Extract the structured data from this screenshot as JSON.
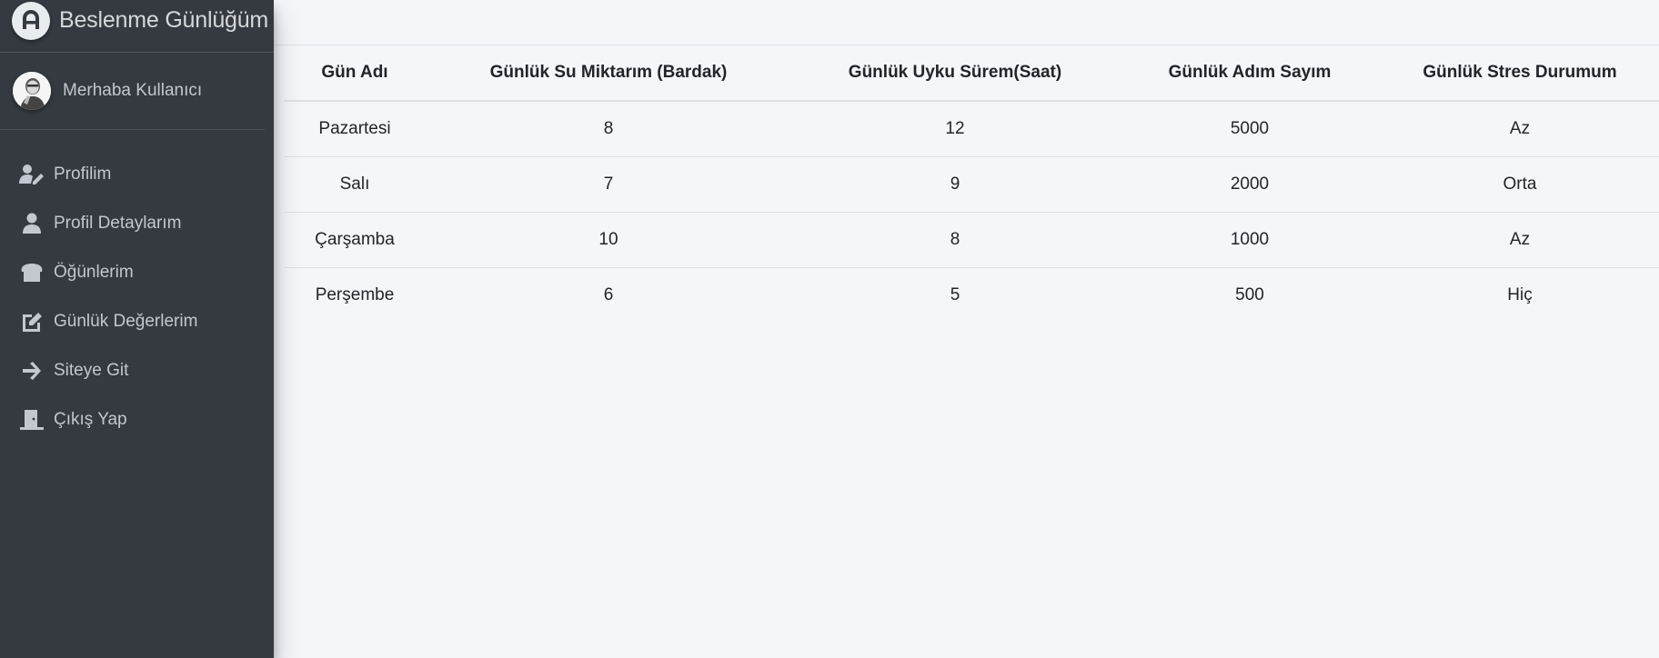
{
  "brand": {
    "title": "Beslenme Günlüğüm",
    "logo_icon": "adminlte-logo-icon"
  },
  "user": {
    "greeting": "Merhaba Kullanıcı",
    "avatar_icon": "user-avatar"
  },
  "sidebar": {
    "items": [
      {
        "label": "Profilim",
        "icon": "user-edit-icon"
      },
      {
        "label": "Profil Detaylarım",
        "icon": "user-icon"
      },
      {
        "label": "Öğünlerim",
        "icon": "bread-icon"
      },
      {
        "label": "Günlük Değerlerim",
        "icon": "edit-icon"
      },
      {
        "label": "Siteye Git",
        "icon": "arrow-right-icon"
      },
      {
        "label": "Çıkış Yap",
        "icon": "door-icon"
      }
    ]
  },
  "table": {
    "headers": [
      "Gün Adı",
      "Günlük Su Miktarım (Bardak)",
      "Günlük Uyku Sürem(Saat)",
      "Günlük Adım Sayım",
      "Günlük Stres Durumum"
    ],
    "rows": [
      [
        "Pazartesi",
        "8",
        "12",
        "5000",
        "Az"
      ],
      [
        "Salı",
        "7",
        "9",
        "2000",
        "Orta"
      ],
      [
        "Çarşamba",
        "10",
        "8",
        "1000",
        "Az"
      ],
      [
        "Perşembe",
        "6",
        "5",
        "500",
        "Hiç"
      ]
    ]
  },
  "colors": {
    "sidebar_bg": "#343a40",
    "sidebar_text": "#c2c7d0",
    "content_bg": "#f4f6f9",
    "border": "#dee2e6"
  }
}
